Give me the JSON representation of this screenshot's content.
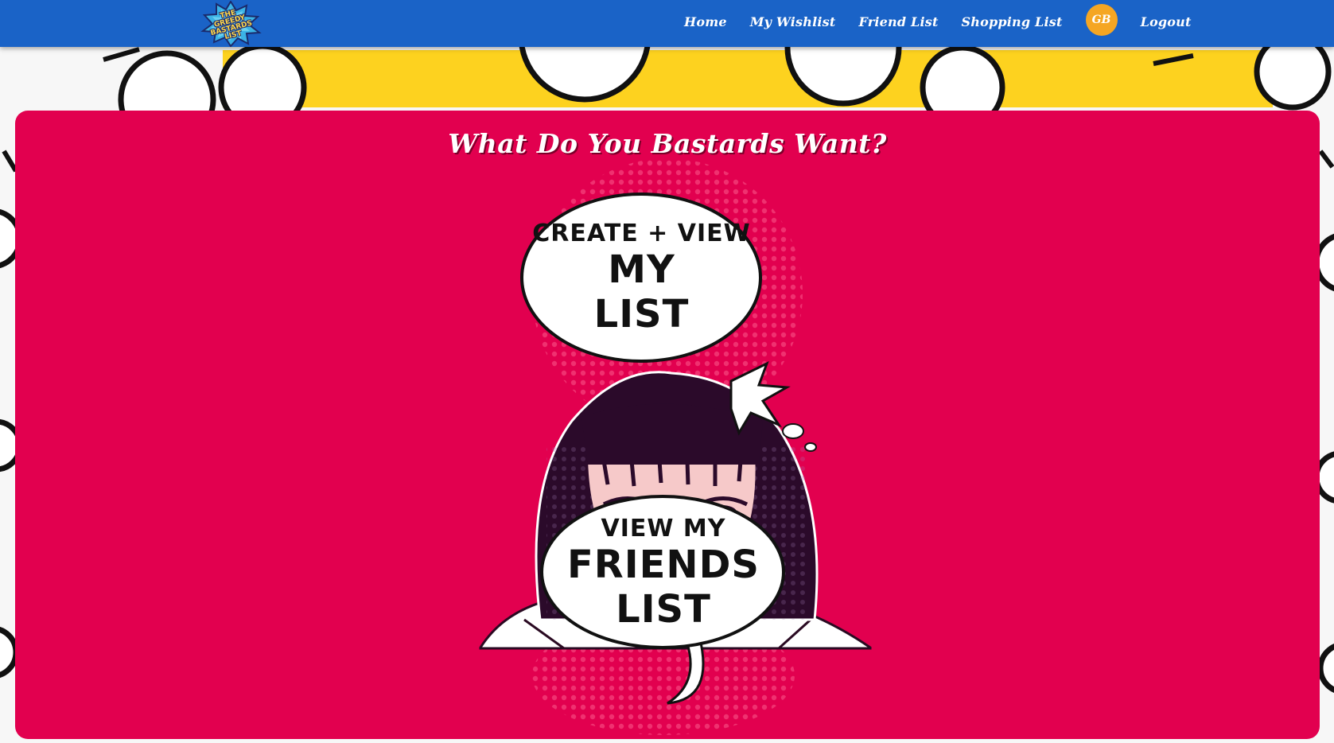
{
  "logo": {
    "text": "THE\nGREEDY\nBASTARDS\nLIST"
  },
  "nav": {
    "links": [
      {
        "label": "Home"
      },
      {
        "label": "My Wishlist"
      },
      {
        "label": "Friend List"
      },
      {
        "label": "Shopping List"
      }
    ],
    "avatar_initials": "GB",
    "logout_label": "Logout"
  },
  "main": {
    "title": "What Do You Bastards Want?",
    "my_list_bubble": {
      "line1": "CREATE + VIEW",
      "line2": "MY",
      "line3": "LIST"
    },
    "friends_bubble": {
      "line1": "VIEW MY",
      "line2": "FRIENDS",
      "line3": "LIST"
    }
  },
  "colors": {
    "navbar": "#1a63c7",
    "card": "#e2004f",
    "avatar": "#f5a623",
    "banner_yellow": "#fdd21f"
  }
}
